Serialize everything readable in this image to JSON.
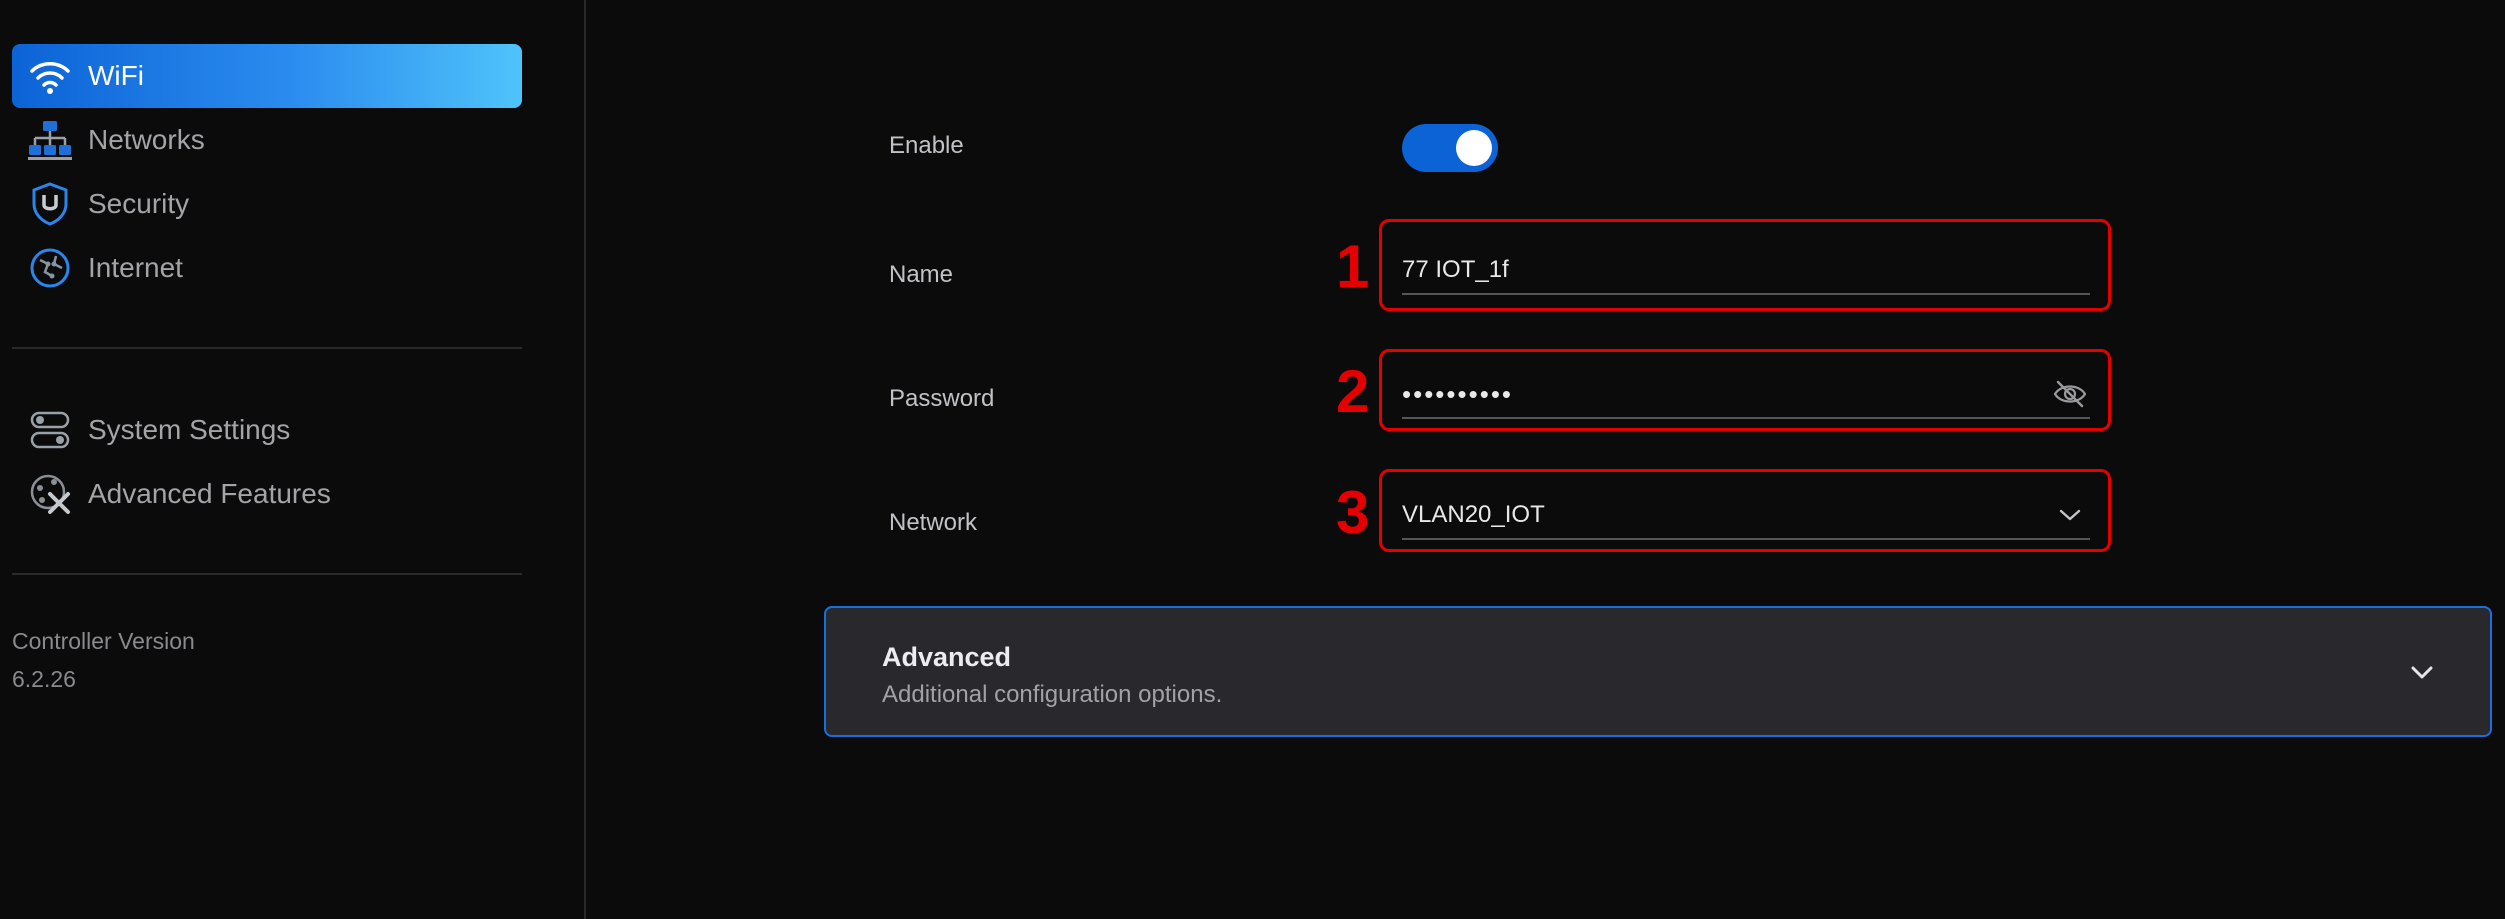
{
  "sidebar": {
    "items": [
      {
        "label": "WiFi",
        "icon": "wifi-icon",
        "active": true
      },
      {
        "label": "Networks",
        "icon": "network-topology-icon",
        "active": false
      },
      {
        "label": "Security",
        "icon": "shield-icon",
        "active": false
      },
      {
        "label": "Internet",
        "icon": "globe-icon",
        "active": false
      }
    ],
    "settings_items": [
      {
        "label": "System Settings",
        "icon": "toggles-icon"
      },
      {
        "label": "Advanced Features",
        "icon": "tools-icon"
      }
    ],
    "version_label": "Controller Version",
    "version_value": "6.2.26"
  },
  "form": {
    "enable_label": "Enable",
    "enabled": true,
    "name_label": "Name",
    "name_value": "77 IOT_1f",
    "password_label": "Password",
    "password_value": "••••••••••",
    "network_label": "Network",
    "network_value": "VLAN20_IOT"
  },
  "callouts": [
    "1",
    "2",
    "3"
  ],
  "advanced": {
    "title": "Advanced",
    "subtitle": "Additional configuration options."
  },
  "colors": {
    "accent": "#0b63d6",
    "callout": "#e30000",
    "background": "#0b0b0c",
    "panel": "#29292d"
  }
}
